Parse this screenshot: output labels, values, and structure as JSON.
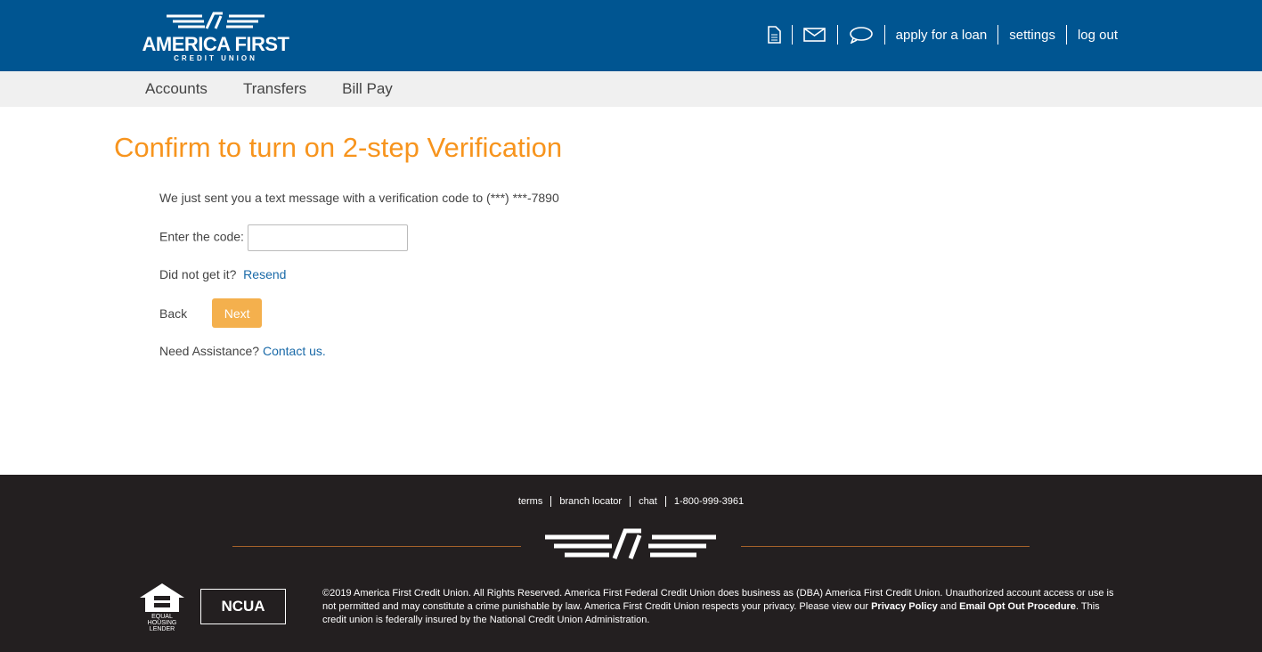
{
  "header": {
    "logo_name": "AMERICA FIRST",
    "logo_sub": "CREDIT UNION",
    "nav": [
      "apply for a loan",
      "settings",
      "log out"
    ]
  },
  "subnav": [
    "Accounts",
    "Transfers",
    "Bill Pay"
  ],
  "main": {
    "title": "Confirm to turn on 2-step Verification",
    "message": "We just sent you a text message with a verification code to (***) ***-7890",
    "code_label": "Enter the code:",
    "code_value": "",
    "not_get": "Did not get it?",
    "resend": "Resend",
    "back": "Back",
    "next": "Next",
    "assist": "Need Assistance?",
    "contact": "Contact us."
  },
  "footer": {
    "links": [
      "terms",
      "branch locator",
      "chat",
      "1-800-999-3961"
    ],
    "ehl": "EQUAL HOUSING LENDER",
    "ncua": "NCUA",
    "legal_1": "©2019 America First Credit Union. All Rights Reserved. America First Federal Credit Union does business as (DBA) America First Credit Union. Unauthorized account access or use is not permitted and may constitute a crime punishable by law. America First Credit Union respects your privacy. Please view our ",
    "privacy": "Privacy Policy",
    "and": " and ",
    "optout": "Email Opt Out Procedure",
    "legal_2": ". This credit union is federally insured by the National Credit Union Administration."
  }
}
